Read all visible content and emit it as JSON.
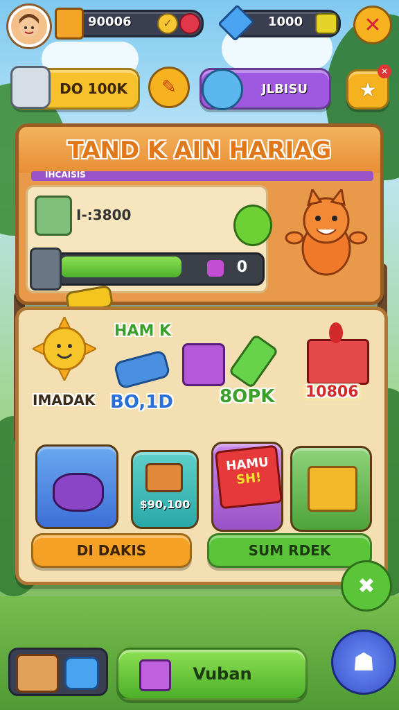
{
  "top_bar": {
    "coins": "90006",
    "gems": "1000"
  },
  "quick_buttons": {
    "left_label": "DO 100K",
    "center_label": "JLBISU"
  },
  "event_panel": {
    "title": "TAND K AIN HARIAG",
    "subtitle": "IHCAISIS",
    "reward_text": "I-:3800",
    "progress_value": "0",
    "progress_fraction": 0.62
  },
  "rewards": {
    "label_top": "HAM K",
    "sun_label": "IMADAK",
    "center_label": "BO,1D",
    "right_small_label": "8OPK",
    "gift_label": "10806"
  },
  "shop": {
    "price_label": "$90,100",
    "sale_label_1": "HAMU",
    "sale_label_2": "SH!",
    "left_button": "DI DAKIS",
    "right_button": "SUM RDEK"
  },
  "bottom_bar": {
    "main_button": "Vuban"
  }
}
